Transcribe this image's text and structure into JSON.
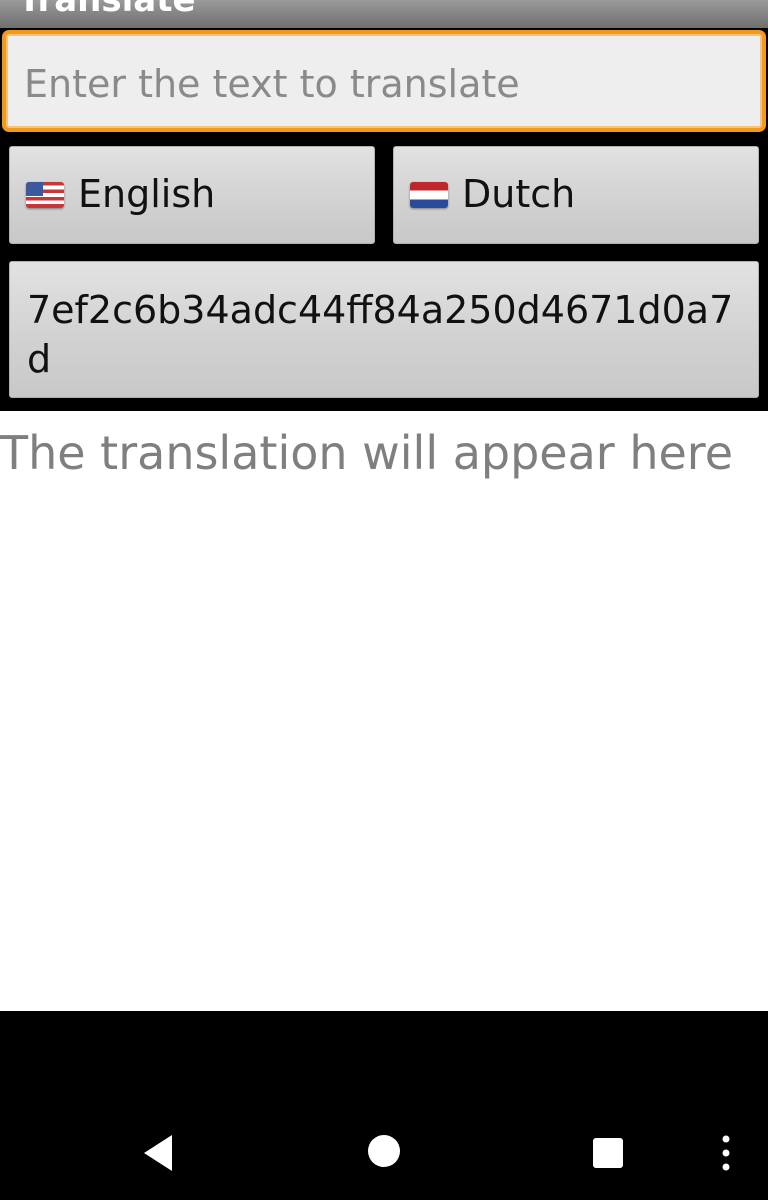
{
  "app": {
    "title": "Translate"
  },
  "input": {
    "placeholder": "Enter the text to translate",
    "value": ""
  },
  "languages": {
    "source": {
      "label": "English",
      "flag": "us-flag-icon"
    },
    "target": {
      "label": "Dutch",
      "flag": "netherlands-flag-icon"
    }
  },
  "key_button": {
    "label": "7ef2c6b34adc44ff84a250d4671d0a7d"
  },
  "result": {
    "text": "The translation will appear here"
  },
  "navbar": {
    "icons": [
      "back-icon",
      "home-icon",
      "recents-icon",
      "more-icon"
    ]
  },
  "colors": {
    "accent": "#f39a1d",
    "placeholder": "#8a8a8a",
    "result_text": "#7f7f7f"
  }
}
